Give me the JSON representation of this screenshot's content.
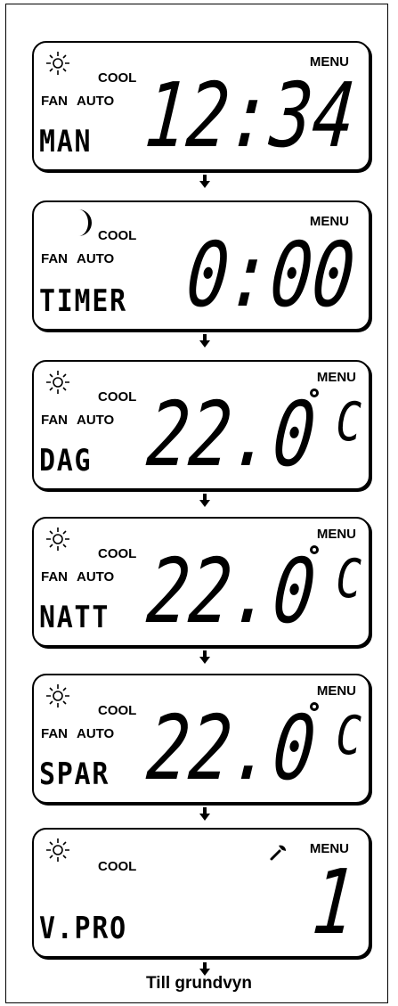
{
  "screens": [
    {
      "icon": "sun-icon",
      "cool": "COOL",
      "fan": "FAN",
      "auto": "AUTO",
      "menu": "MENU",
      "mode": "MAN",
      "value": "12:34",
      "unit": ""
    },
    {
      "icon": "moon-icon",
      "cool": "COOL",
      "fan": "FAN",
      "auto": "AUTO",
      "menu": "MENU",
      "mode": "TIMER",
      "value": "0:00",
      "unit": ""
    },
    {
      "icon": "sun-icon",
      "cool": "COOL",
      "fan": "FAN",
      "auto": "AUTO",
      "menu": "MENU",
      "mode": "DAG",
      "value": "22.0",
      "unit": "C"
    },
    {
      "icon": "sun-icon",
      "cool": "COOL",
      "fan": "FAN",
      "auto": "AUTO",
      "menu": "MENU",
      "mode": "NATT",
      "value": "22.0",
      "unit": "C"
    },
    {
      "icon": "sun-icon",
      "cool": "COOL",
      "fan": "FAN",
      "auto": "AUTO",
      "menu": "MENU",
      "mode": "SPAR",
      "value": "22.0",
      "unit": "C"
    },
    {
      "icon": "sun-icon",
      "cool": "COOL",
      "fan": "",
      "auto": "",
      "menu": "MENU",
      "mode": "V.PRO",
      "value": "1",
      "unit": "",
      "extra_icon": "wrench-icon"
    }
  ],
  "caption": "Till grundvyn"
}
